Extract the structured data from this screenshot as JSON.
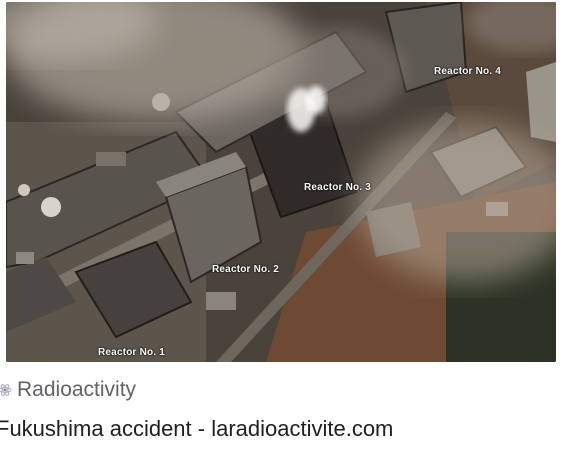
{
  "image": {
    "alt_semantic": "fukushima-reactor-aerial-photo",
    "labels": {
      "reactor4": "Reactor No. 4",
      "reactor3": "Reactor No. 3",
      "reactor2": "Reactor No. 2",
      "reactor1": "Reactor No. 1"
    }
  },
  "source": {
    "name": "Radioactivity",
    "icon": "atom-icon"
  },
  "title": "Fukushima accident - laradioactivite.com"
}
